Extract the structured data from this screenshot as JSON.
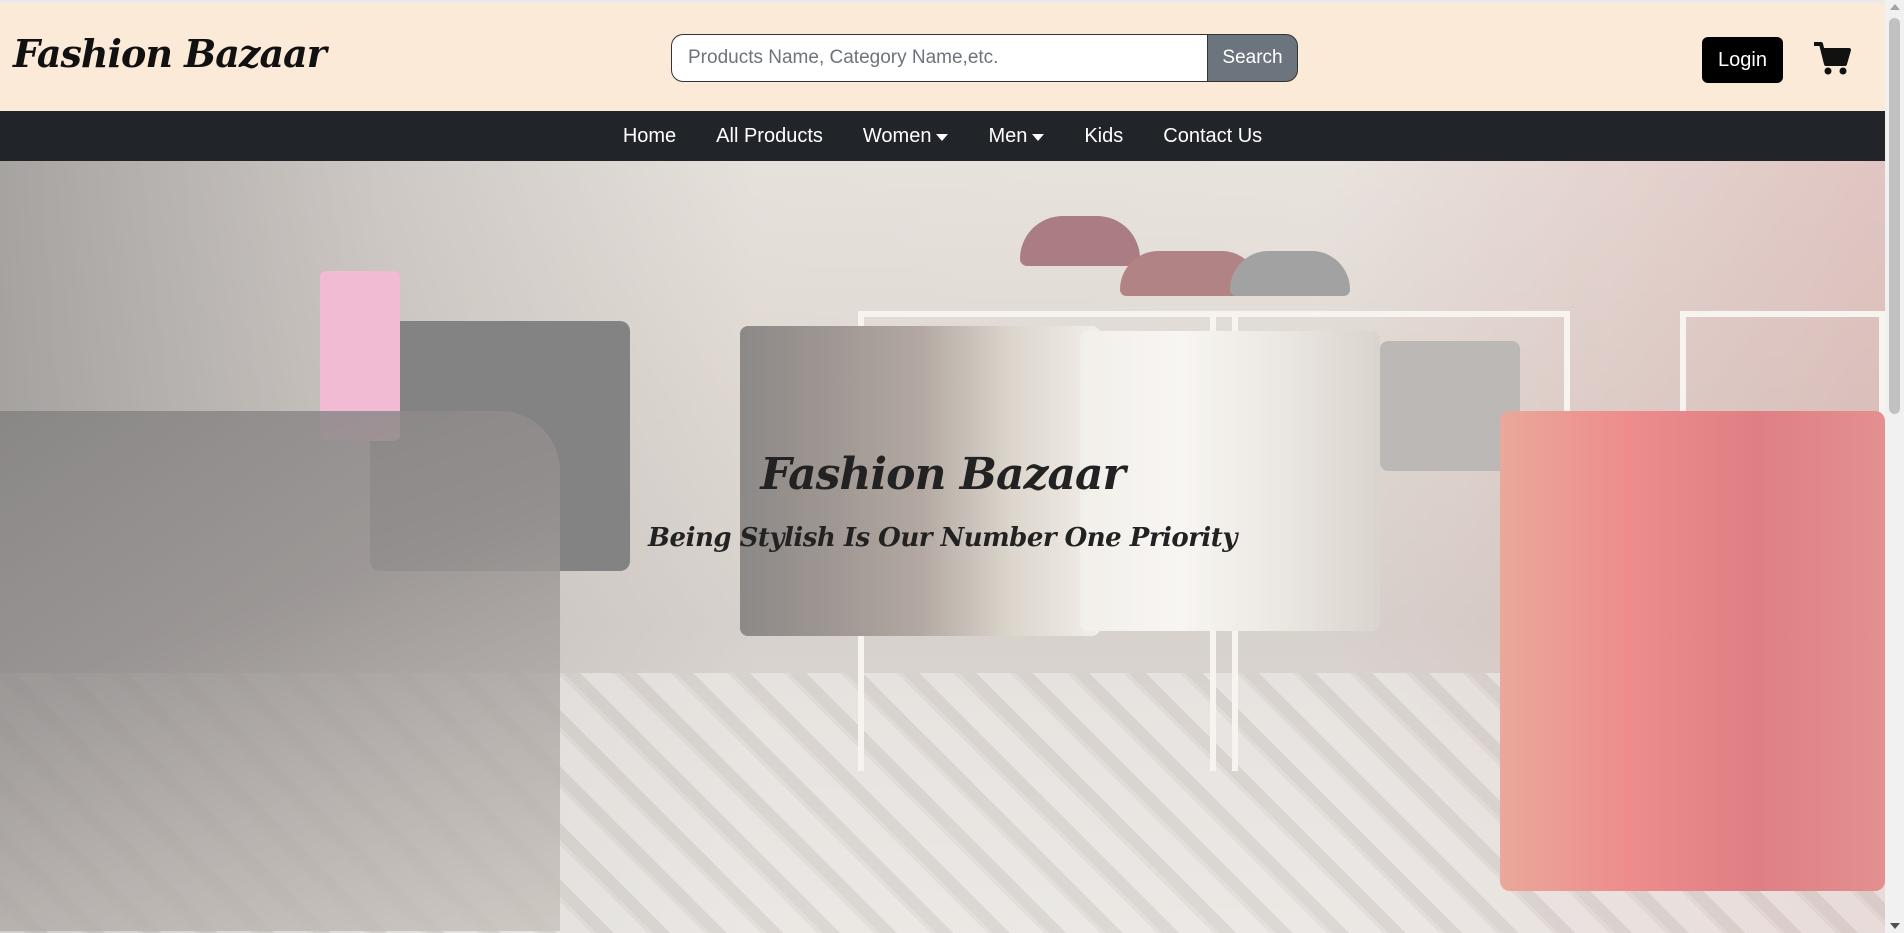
{
  "header": {
    "brand": "Fashion Bazaar",
    "search_placeholder": "Products Name, Category Name,etc.",
    "search_label": "Search",
    "login_label": "Login",
    "cart_icon": "cart-icon"
  },
  "nav": {
    "items": [
      {
        "label": "Home"
      },
      {
        "label": "All Products"
      },
      {
        "label": "Women",
        "dropdown": true
      },
      {
        "label": "Men",
        "dropdown": true
      },
      {
        "label": "Kids"
      },
      {
        "label": "Contact Us"
      }
    ]
  },
  "hero": {
    "title": "Fashion Bazaar",
    "subtitle": "Being Stylish Is Our Number One Priority"
  },
  "colors": {
    "header_bg": "#fbead7",
    "nav_bg": "#212529",
    "search_button": "#6c757d",
    "login_button": "#000000"
  }
}
